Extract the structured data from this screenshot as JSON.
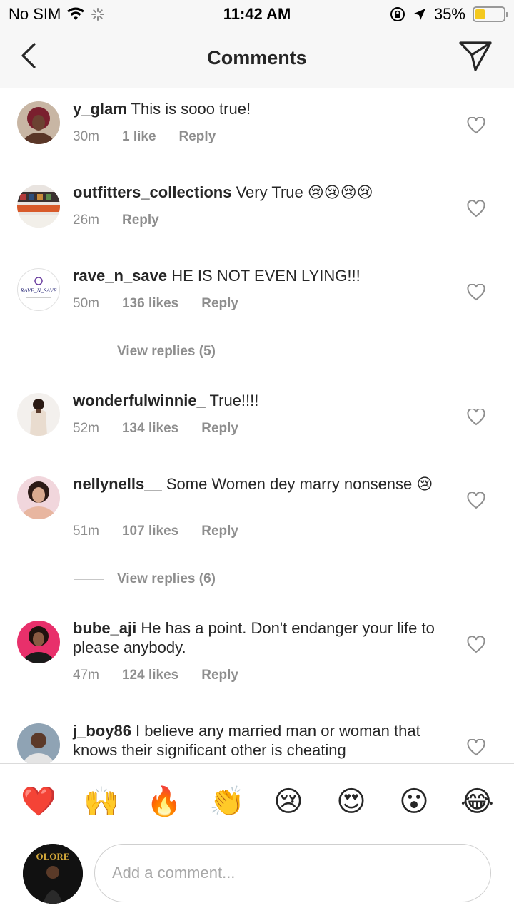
{
  "status_bar": {
    "carrier": "No SIM",
    "time": "11:42 AM",
    "battery": "35%",
    "battery_level": 0.35
  },
  "header": {
    "title": "Comments"
  },
  "comments": [
    {
      "user": "y_glam",
      "text": " This is sooo true!",
      "time": "30m",
      "likes": "1 like",
      "reply": "Reply"
    },
    {
      "user": "outfitters_collections",
      "text": " Very True 😢😢😢😢",
      "time": "26m",
      "likes": "",
      "reply": "Reply"
    },
    {
      "user": "rave_n_save",
      "text": " HE IS NOT EVEN LYING!!!",
      "time": "50m",
      "likes": "136 likes",
      "reply": "Reply",
      "view_replies": "View replies (5)"
    },
    {
      "user": "wonderfulwinnie_",
      "text": " True!!!!",
      "time": "52m",
      "likes": "134 likes",
      "reply": "Reply"
    },
    {
      "user": "nellynells__",
      "text": " Some Women dey marry nonsense 😢",
      "time": "51m",
      "likes": "107 likes",
      "reply": "Reply",
      "view_replies": "View replies (6)"
    },
    {
      "user": "bube_aji",
      "text": " He has a point. Don't endanger your life to please anybody.",
      "time": "47m",
      "likes": "124 likes",
      "reply": "Reply"
    },
    {
      "user": "j_boy86",
      "text": " I believe any married man or woman that knows their significant other is cheating"
    }
  ],
  "rave_avatar_text": "RAVE_N_SAVE",
  "my_avatar_text": "OLORE",
  "emojis": [
    "❤️",
    "🙌",
    "🔥",
    "👏",
    "😢",
    "😍",
    "😮",
    "😂"
  ],
  "input": {
    "placeholder": "Add a comment..."
  },
  "colors": {
    "text": "#262626",
    "meta": "#8e8e8e",
    "header_bg": "#f7f7f7",
    "battery": "#f4c91f"
  },
  "icons": [
    "back-chevron-icon",
    "send-icon",
    "heart-outline-icon",
    "wifi-icon",
    "orientation-lock-icon",
    "location-arrow-icon"
  ]
}
